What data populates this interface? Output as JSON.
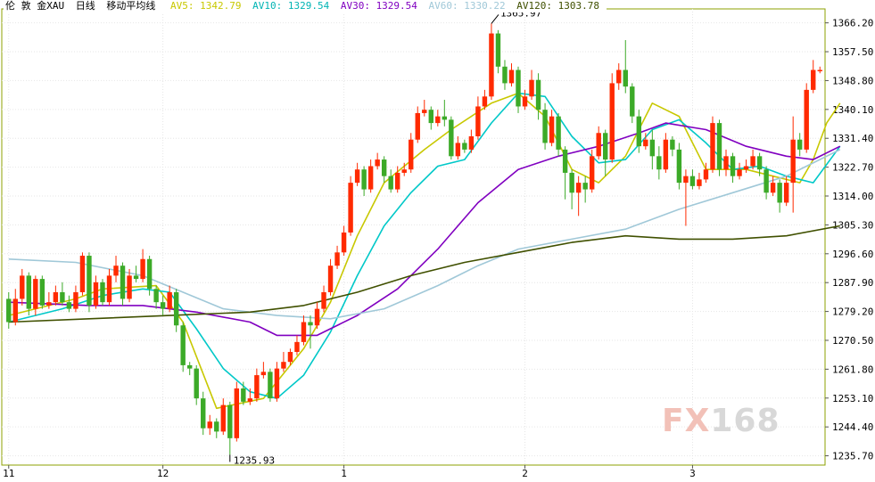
{
  "legend": {
    "symbol": "伦 敦 金XAU",
    "period": "日线",
    "indicator": "移动平均线",
    "items": [
      {
        "label": "AV5: 1342.79",
        "color": "#c8c800"
      },
      {
        "label": "AV10: 1329.54",
        "color": "#00c8c8"
      },
      {
        "label": "AV30: 1329.54",
        "color": "#8000c0"
      },
      {
        "label": "AV60: 1330.22",
        "color": "#a0c8d8"
      },
      {
        "label": "AV120: 1303.78",
        "color": "#405000"
      }
    ]
  },
  "colors": {
    "up": "#ff2a00",
    "down": "#3caa28",
    "grid": "#e6e6e6",
    "frame": "#8ca000"
  },
  "watermark": {
    "fx": "FX",
    "num": "168"
  },
  "annotations": {
    "high": "1365.97",
    "low": "1235.93"
  },
  "chart_data": {
    "type": "candlestick",
    "ylim": [
      1232.9,
      1370.4
    ],
    "y_ticks": [
      "1366.20",
      "1357.50",
      "1348.80",
      "1340.10",
      "1331.40",
      "1322.70",
      "1314.00",
      "1305.30",
      "1296.60",
      "1287.90",
      "1279.20",
      "1270.50",
      "1261.80",
      "1253.10",
      "1244.40",
      "1235.70"
    ],
    "x_ticks": [
      {
        "label": "11",
        "index": 0
      },
      {
        "label": "12",
        "index": 23
      },
      {
        "label": "1",
        "index": 50
      },
      {
        "label": "2",
        "index": 77
      },
      {
        "label": "3",
        "index": 102
      }
    ],
    "candles": [
      [
        1283,
        1276,
        1285,
        1274
      ],
      [
        1276,
        1283,
        1286,
        1275
      ],
      [
        1283,
        1290,
        1292,
        1281
      ],
      [
        1290,
        1280,
        1291,
        1278
      ],
      [
        1280,
        1289,
        1290,
        1278
      ],
      [
        1289,
        1281,
        1290,
        1280
      ],
      [
        1281,
        1282,
        1285,
        1280
      ],
      [
        1282,
        1285,
        1287,
        1281
      ],
      [
        1285,
        1282,
        1288,
        1281
      ],
      [
        1282,
        1280,
        1284,
        1279
      ],
      [
        1280,
        1285,
        1287,
        1279
      ],
      [
        1285,
        1296,
        1297,
        1284
      ],
      [
        1296,
        1281,
        1297,
        1279
      ],
      [
        1281,
        1288,
        1290,
        1280
      ],
      [
        1288,
        1282,
        1289,
        1281
      ],
      [
        1282,
        1290,
        1292,
        1281
      ],
      [
        1290,
        1293,
        1296,
        1288
      ],
      [
        1293,
        1283,
        1294,
        1281
      ],
      [
        1283,
        1290,
        1292,
        1282
      ],
      [
        1290,
        1289,
        1293,
        1288
      ],
      [
        1289,
        1295,
        1298,
        1288
      ],
      [
        1295,
        1286,
        1296,
        1284
      ],
      [
        1286,
        1282,
        1287,
        1280
      ],
      [
        1282,
        1280,
        1284,
        1278
      ],
      [
        1280,
        1285,
        1287,
        1279
      ],
      [
        1285,
        1275,
        1286,
        1273
      ],
      [
        1275,
        1263,
        1276,
        1261
      ],
      [
        1263,
        1262,
        1264,
        1260
      ],
      [
        1262,
        1253,
        1263,
        1251
      ],
      [
        1253,
        1244,
        1255,
        1242
      ],
      [
        1244,
        1246,
        1248,
        1242
      ],
      [
        1246,
        1243,
        1247,
        1241
      ],
      [
        1243,
        1251,
        1253,
        1242
      ],
      [
        1251,
        1241,
        1252,
        1236
      ],
      [
        1241,
        1256,
        1258,
        1240
      ],
      [
        1256,
        1252,
        1258,
        1251
      ],
      [
        1252,
        1253,
        1256,
        1251
      ],
      [
        1253,
        1260,
        1262,
        1252
      ],
      [
        1260,
        1261,
        1264,
        1259
      ],
      [
        1261,
        1253,
        1262,
        1252
      ],
      [
        1253,
        1262,
        1264,
        1252
      ],
      [
        1262,
        1264,
        1267,
        1261
      ],
      [
        1264,
        1267,
        1268,
        1263
      ],
      [
        1267,
        1270,
        1272,
        1266
      ],
      [
        1270,
        1276,
        1278,
        1269
      ],
      [
        1276,
        1275,
        1278,
        1268
      ],
      [
        1275,
        1280,
        1282,
        1274
      ],
      [
        1280,
        1285,
        1287,
        1279
      ],
      [
        1285,
        1293,
        1295,
        1284
      ],
      [
        1293,
        1297,
        1299,
        1292
      ],
      [
        1297,
        1303,
        1305,
        1296
      ],
      [
        1303,
        1318,
        1320,
        1302
      ],
      [
        1318,
        1322,
        1324,
        1317
      ],
      [
        1322,
        1316,
        1323,
        1314
      ],
      [
        1316,
        1323,
        1325,
        1315
      ],
      [
        1323,
        1325,
        1327,
        1322
      ],
      [
        1325,
        1320,
        1326,
        1318
      ],
      [
        1320,
        1316,
        1322,
        1315
      ],
      [
        1316,
        1321,
        1323,
        1315
      ],
      [
        1321,
        1322,
        1324,
        1320
      ],
      [
        1322,
        1331,
        1333,
        1321
      ],
      [
        1331,
        1339,
        1341,
        1330
      ],
      [
        1339,
        1340,
        1343,
        1338
      ],
      [
        1340,
        1336,
        1341,
        1334
      ],
      [
        1336,
        1338,
        1340,
        1335
      ],
      [
        1338,
        1337,
        1343,
        1335
      ],
      [
        1337,
        1326,
        1338,
        1325
      ],
      [
        1326,
        1330,
        1332,
        1325
      ],
      [
        1330,
        1328,
        1331,
        1327
      ],
      [
        1328,
        1332,
        1334,
        1327
      ],
      [
        1332,
        1341,
        1344,
        1331
      ],
      [
        1341,
        1344,
        1346,
        1340
      ],
      [
        1344,
        1363,
        1366,
        1343
      ],
      [
        1363,
        1353,
        1364,
        1351
      ],
      [
        1353,
        1348,
        1355,
        1346
      ],
      [
        1348,
        1352,
        1354,
        1347
      ],
      [
        1352,
        1341,
        1353,
        1339
      ],
      [
        1341,
        1344,
        1346,
        1340
      ],
      [
        1344,
        1349,
        1352,
        1343
      ],
      [
        1349,
        1340,
        1351,
        1337
      ],
      [
        1340,
        1330,
        1342,
        1328
      ],
      [
        1330,
        1338,
        1340,
        1329
      ],
      [
        1338,
        1328,
        1339,
        1326
      ],
      [
        1328,
        1321,
        1329,
        1313
      ],
      [
        1321,
        1315,
        1322,
        1310
      ],
      [
        1315,
        1318,
        1320,
        1308
      ],
      [
        1318,
        1316,
        1320,
        1312
      ],
      [
        1316,
        1326,
        1328,
        1315
      ],
      [
        1326,
        1333,
        1335,
        1325
      ],
      [
        1333,
        1325,
        1334,
        1320
      ],
      [
        1325,
        1348,
        1351,
        1324
      ],
      [
        1348,
        1352,
        1354,
        1346
      ],
      [
        1352,
        1347,
        1361,
        1345
      ],
      [
        1347,
        1338,
        1348,
        1336
      ],
      [
        1338,
        1329,
        1340,
        1327
      ],
      [
        1329,
        1331,
        1333,
        1328
      ],
      [
        1331,
        1326,
        1334,
        1322
      ],
      [
        1326,
        1322,
        1329,
        1319
      ],
      [
        1322,
        1331,
        1333,
        1321
      ],
      [
        1331,
        1328,
        1332,
        1326
      ],
      [
        1328,
        1318,
        1330,
        1316
      ],
      [
        1318,
        1320,
        1322,
        1305
      ],
      [
        1320,
        1317,
        1322,
        1316
      ],
      [
        1317,
        1319,
        1321,
        1316
      ],
      [
        1319,
        1322,
        1324,
        1318
      ],
      [
        1322,
        1336,
        1338,
        1321
      ],
      [
        1336,
        1322,
        1337,
        1320
      ],
      [
        1322,
        1326,
        1328,
        1320
      ],
      [
        1326,
        1320,
        1327,
        1318
      ],
      [
        1320,
        1322,
        1324,
        1319
      ],
      [
        1322,
        1323,
        1325,
        1321
      ],
      [
        1323,
        1326,
        1328,
        1322
      ],
      [
        1326,
        1322,
        1327,
        1320
      ],
      [
        1322,
        1315,
        1323,
        1313
      ],
      [
        1315,
        1318,
        1320,
        1314
      ],
      [
        1318,
        1312,
        1319,
        1309
      ],
      [
        1312,
        1318,
        1320,
        1311
      ],
      [
        1318,
        1331,
        1338,
        1309
      ],
      [
        1331,
        1328,
        1333,
        1326
      ],
      [
        1328,
        1346,
        1348,
        1327
      ],
      [
        1346,
        1352,
        1355,
        1345
      ],
      [
        1352,
        1352,
        1353,
        1351
      ]
    ],
    "ma_lines": [
      {
        "name": "AV5",
        "color": "#c8c800",
        "points": [
          [
            0,
            1278
          ],
          [
            10,
            1283
          ],
          [
            14,
            1286
          ],
          [
            22,
            1287
          ],
          [
            26,
            1276
          ],
          [
            31,
            1250
          ],
          [
            38,
            1253
          ],
          [
            44,
            1268
          ],
          [
            48,
            1282
          ],
          [
            52,
            1302
          ],
          [
            56,
            1318
          ],
          [
            62,
            1328
          ],
          [
            66,
            1334
          ],
          [
            72,
            1342
          ],
          [
            76,
            1345
          ],
          [
            80,
            1338
          ],
          [
            84,
            1322
          ],
          [
            88,
            1318
          ],
          [
            92,
            1326
          ],
          [
            96,
            1342
          ],
          [
            100,
            1338
          ],
          [
            104,
            1322
          ],
          [
            110,
            1322
          ],
          [
            114,
            1320
          ],
          [
            118,
            1318
          ],
          [
            120,
            1325
          ],
          [
            122,
            1336
          ],
          [
            124,
            1342
          ]
        ]
      },
      {
        "name": "AV10",
        "color": "#00c8c8",
        "points": [
          [
            0,
            1276
          ],
          [
            8,
            1280
          ],
          [
            14,
            1284
          ],
          [
            20,
            1286
          ],
          [
            24,
            1285
          ],
          [
            28,
            1274
          ],
          [
            32,
            1262
          ],
          [
            36,
            1255
          ],
          [
            40,
            1253
          ],
          [
            44,
            1260
          ],
          [
            48,
            1273
          ],
          [
            52,
            1290
          ],
          [
            56,
            1305
          ],
          [
            60,
            1315
          ],
          [
            64,
            1323
          ],
          [
            68,
            1325
          ],
          [
            72,
            1336
          ],
          [
            76,
            1345
          ],
          [
            80,
            1344
          ],
          [
            84,
            1332
          ],
          [
            88,
            1324
          ],
          [
            92,
            1325
          ],
          [
            96,
            1334
          ],
          [
            100,
            1337
          ],
          [
            104,
            1330
          ],
          [
            108,
            1322
          ],
          [
            112,
            1323
          ],
          [
            116,
            1320
          ],
          [
            120,
            1318
          ],
          [
            124,
            1329
          ]
        ]
      },
      {
        "name": "AV30",
        "color": "#8000c0",
        "points": [
          [
            0,
            1282
          ],
          [
            12,
            1281
          ],
          [
            20,
            1281
          ],
          [
            28,
            1279
          ],
          [
            36,
            1276
          ],
          [
            40,
            1272
          ],
          [
            46,
            1272
          ],
          [
            52,
            1278
          ],
          [
            58,
            1286
          ],
          [
            64,
            1298
          ],
          [
            70,
            1312
          ],
          [
            76,
            1322
          ],
          [
            82,
            1326
          ],
          [
            88,
            1329
          ],
          [
            94,
            1333
          ],
          [
            98,
            1336
          ],
          [
            104,
            1334
          ],
          [
            110,
            1329
          ],
          [
            116,
            1326
          ],
          [
            120,
            1325
          ],
          [
            124,
            1329
          ]
        ]
      },
      {
        "name": "AV60",
        "color": "#a0c8d8",
        "points": [
          [
            0,
            1295
          ],
          [
            10,
            1294
          ],
          [
            20,
            1290
          ],
          [
            26,
            1285
          ],
          [
            32,
            1280
          ],
          [
            40,
            1278
          ],
          [
            48,
            1277
          ],
          [
            56,
            1280
          ],
          [
            64,
            1287
          ],
          [
            70,
            1293
          ],
          [
            76,
            1298
          ],
          [
            84,
            1301
          ],
          [
            92,
            1304
          ],
          [
            100,
            1310
          ],
          [
            108,
            1315
          ],
          [
            116,
            1320
          ],
          [
            124,
            1328
          ]
        ]
      },
      {
        "name": "AV120",
        "color": "#405000",
        "points": [
          [
            0,
            1276
          ],
          [
            12,
            1277
          ],
          [
            24,
            1278
          ],
          [
            36,
            1279
          ],
          [
            44,
            1281
          ],
          [
            52,
            1285
          ],
          [
            60,
            1290
          ],
          [
            68,
            1294
          ],
          [
            76,
            1297
          ],
          [
            84,
            1300
          ],
          [
            92,
            1302
          ],
          [
            100,
            1301
          ],
          [
            108,
            1301
          ],
          [
            116,
            1302
          ],
          [
            124,
            1305
          ]
        ]
      }
    ]
  }
}
